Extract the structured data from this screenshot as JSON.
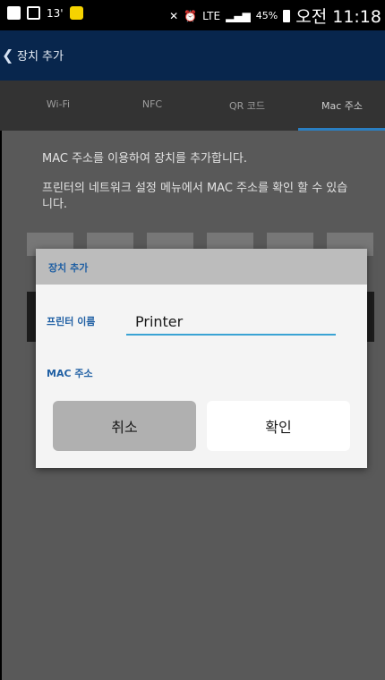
{
  "status_bar": {
    "signal_text": "13'",
    "network": "LTE",
    "battery": "45%",
    "time": "오전 11:18"
  },
  "app_bar": {
    "title": "장치 추가",
    "back_icon": "chevron-left-icon"
  },
  "tabs": [
    {
      "label": "Wi-Fi",
      "active": false
    },
    {
      "label": "NFC",
      "active": false
    },
    {
      "label": "QR 코드",
      "active": false
    },
    {
      "label": "Mac 주소",
      "active": true
    }
  ],
  "content": {
    "description": "MAC 주소를 이용하여 장치를 추가합니다.",
    "hint": "프린터의 네트워크 설정 메뉴에서 MAC 주소를 확인 할 수 있습니다."
  },
  "dialog": {
    "title": "장치 추가",
    "printer_name_label": "프린터 이름",
    "printer_name_value": "Printer",
    "mac_label": "MAC 주소",
    "cancel_label": "취소",
    "ok_label": "확인"
  },
  "colors": {
    "app_bar": "#08264d",
    "accent": "#2a7fc2",
    "label_blue": "#1f5fa3"
  }
}
